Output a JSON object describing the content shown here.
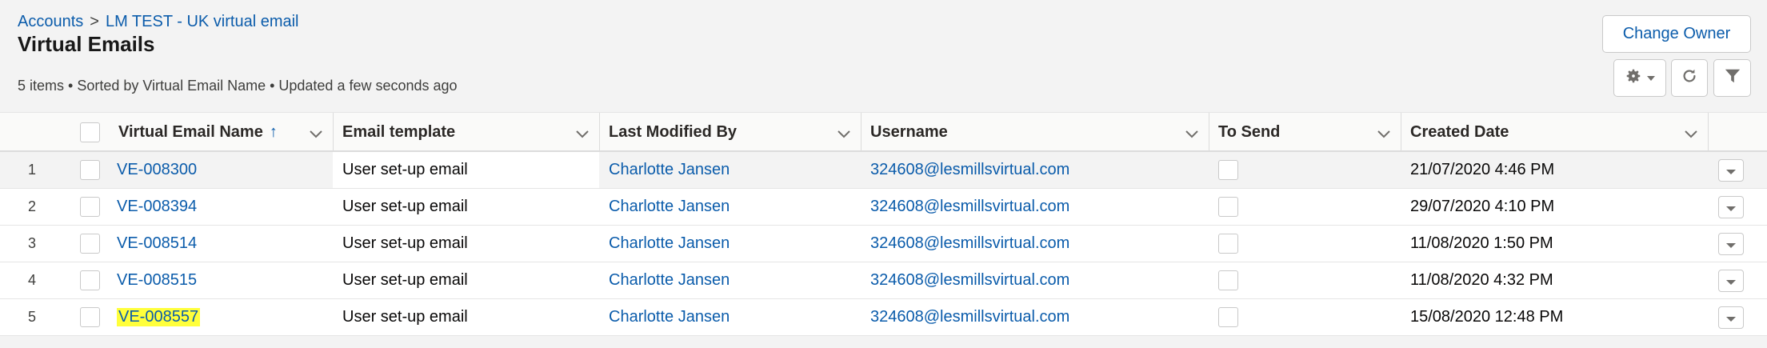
{
  "breadcrumb": {
    "parent": "Accounts",
    "separator": ">",
    "current": "LM TEST - UK virtual email"
  },
  "page": {
    "title": "Virtual Emails",
    "meta": "5 items • Sorted by Virtual Email Name • Updated a few seconds ago"
  },
  "actions": {
    "change_owner": "Change Owner"
  },
  "icons": [
    "gear-icon",
    "chevron-down-icon",
    "refresh-icon",
    "filter-icon",
    "sort-ascending-icon"
  ],
  "colors": {
    "link": "#0b5cab",
    "highlight": "#ffff3b"
  },
  "columns": {
    "name": "Virtual Email Name",
    "sort_arrow": "↑",
    "template": "Email template",
    "modified": "Last Modified By",
    "username": "Username",
    "to_send": "To Send",
    "created": "Created Date"
  },
  "rows": [
    {
      "num": "1",
      "name": "VE-008300",
      "template": "User set-up email",
      "modified_by": "Charlotte Jansen",
      "username": "324608@lesmillsvirtual.com",
      "to_send": false,
      "created": "21/07/2020 4:46 PM"
    },
    {
      "num": "2",
      "name": "VE-008394",
      "template": "User set-up email",
      "modified_by": "Charlotte Jansen",
      "username": "324608@lesmillsvirtual.com",
      "to_send": false,
      "created": "29/07/2020 4:10 PM"
    },
    {
      "num": "3",
      "name": "VE-008514",
      "template": "User set-up email",
      "modified_by": "Charlotte Jansen",
      "username": "324608@lesmillsvirtual.com",
      "to_send": false,
      "created": "11/08/2020 1:50 PM"
    },
    {
      "num": "4",
      "name": "VE-008515",
      "template": "User set-up email",
      "modified_by": "Charlotte Jansen",
      "username": "324608@lesmillsvirtual.com",
      "to_send": false,
      "created": "11/08/2020 4:32 PM"
    },
    {
      "num": "5",
      "name": "VE-008557",
      "template": "User set-up email",
      "modified_by": "Charlotte Jansen",
      "username": "324608@lesmillsvirtual.com",
      "to_send": false,
      "created": "15/08/2020 12:48 PM",
      "highlighted": true
    }
  ]
}
